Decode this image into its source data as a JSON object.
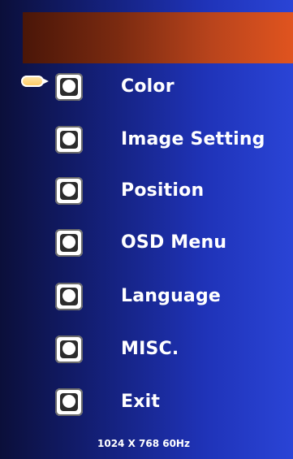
{
  "menu": {
    "items": [
      {
        "label": "Color",
        "icon": "color-icon"
      },
      {
        "label": "Image Setting",
        "icon": "image-setting-icon"
      },
      {
        "label": "Position",
        "icon": "position-icon"
      },
      {
        "label": "OSD Menu",
        "icon": "osd-menu-icon"
      },
      {
        "label": "Language",
        "icon": "language-icon"
      },
      {
        "label": "MISC.",
        "icon": "misc-icon"
      },
      {
        "label": "Exit",
        "icon": "exit-icon"
      }
    ],
    "selected_index": 0
  },
  "footer": {
    "resolution_text": "1024 X 768  60Hz"
  },
  "colors": {
    "background_left": "#0b0f3a",
    "background_right": "#2a44d6",
    "header_left": "#4a1608",
    "header_right": "#e0541f",
    "selector": "#ffc85a",
    "text": "#ffffff"
  }
}
